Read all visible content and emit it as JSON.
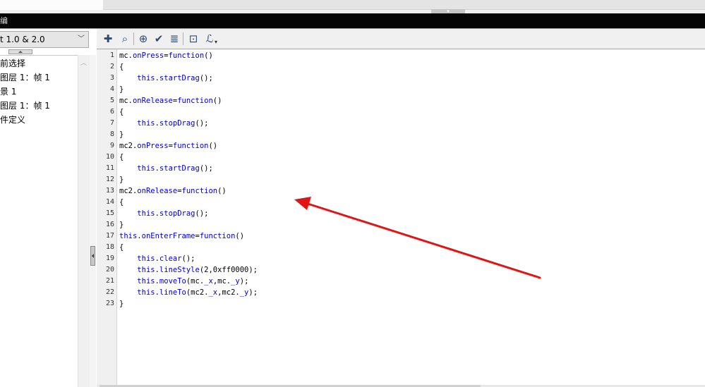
{
  "window": {
    "title_fragment": "编"
  },
  "left_panel": {
    "version_dropdown": {
      "selected": "t 1.0 & 2.0",
      "arrow": "chevron-down"
    },
    "tree_items": [
      {
        "label": "前选择"
      },
      {
        "label": " 图层 1：帧 1"
      },
      {
        "label": "景 1"
      },
      {
        "label": " 图层 1：帧 1"
      },
      {
        "label": "件定义"
      }
    ]
  },
  "toolbar": {
    "buttons": [
      {
        "name": "add-statement",
        "icon": "plus-icon",
        "glyph": "✚"
      },
      {
        "name": "find",
        "icon": "find-icon",
        "glyph": "⌕"
      },
      {
        "name": "insert-target-path",
        "icon": "crosshair-icon",
        "glyph": "⊕"
      },
      {
        "name": "check-syntax",
        "icon": "checkmark-icon",
        "glyph": "✔"
      },
      {
        "name": "auto-format",
        "icon": "format-icon",
        "glyph": "≣"
      },
      {
        "name": "show-code-hint",
        "icon": "code-hint-icon",
        "glyph": "⊡"
      },
      {
        "name": "debug-options",
        "icon": "debug-icon",
        "glyph": "ℒ"
      }
    ]
  },
  "editor": {
    "accent_keyword": "#0000c8",
    "lines": [
      {
        "n": "1",
        "parts": [
          [
            "mc.",
            ""
          ],
          [
            "onPress",
            "kw"
          ],
          [
            "=",
            ""
          ],
          [
            "function",
            "kw"
          ],
          [
            "()",
            ""
          ]
        ]
      },
      {
        "n": "2",
        "parts": [
          [
            "{",
            ""
          ]
        ]
      },
      {
        "n": "3",
        "parts": [
          [
            "    ",
            ""
          ],
          [
            "this",
            "kw"
          ],
          [
            ".",
            ""
          ],
          [
            "startDrag",
            "kw"
          ],
          [
            "();",
            ""
          ]
        ]
      },
      {
        "n": "4",
        "parts": [
          [
            "}",
            ""
          ]
        ]
      },
      {
        "n": "5",
        "parts": [
          [
            "mc.",
            ""
          ],
          [
            "onRelease",
            "kw"
          ],
          [
            "=",
            ""
          ],
          [
            "function",
            "kw"
          ],
          [
            "()",
            ""
          ]
        ]
      },
      {
        "n": "6",
        "parts": [
          [
            "{",
            ""
          ]
        ]
      },
      {
        "n": "7",
        "parts": [
          [
            "    ",
            ""
          ],
          [
            "this",
            "kw"
          ],
          [
            ".",
            ""
          ],
          [
            "stopDrag",
            "kw"
          ],
          [
            "();",
            ""
          ]
        ]
      },
      {
        "n": "8",
        "parts": [
          [
            "}",
            ""
          ]
        ]
      },
      {
        "n": "9",
        "parts": [
          [
            "mc2.",
            ""
          ],
          [
            "onPress",
            "kw"
          ],
          [
            "=",
            ""
          ],
          [
            "function",
            "kw"
          ],
          [
            "()",
            ""
          ]
        ]
      },
      {
        "n": "10",
        "parts": [
          [
            "{",
            ""
          ]
        ]
      },
      {
        "n": "11",
        "parts": [
          [
            "    ",
            ""
          ],
          [
            "this",
            "kw"
          ],
          [
            ".",
            ""
          ],
          [
            "startDrag",
            "kw"
          ],
          [
            "();",
            ""
          ]
        ]
      },
      {
        "n": "12",
        "parts": [
          [
            "}",
            ""
          ]
        ]
      },
      {
        "n": "13",
        "parts": [
          [
            "mc2.",
            ""
          ],
          [
            "onRelease",
            "kw"
          ],
          [
            "=",
            ""
          ],
          [
            "function",
            "kw"
          ],
          [
            "()",
            ""
          ]
        ]
      },
      {
        "n": "14",
        "parts": [
          [
            "{",
            ""
          ]
        ]
      },
      {
        "n": "15",
        "parts": [
          [
            "    ",
            ""
          ],
          [
            "this",
            "kw"
          ],
          [
            ".",
            ""
          ],
          [
            "stopDrag",
            "kw"
          ],
          [
            "();",
            ""
          ]
        ]
      },
      {
        "n": "16",
        "parts": [
          [
            "}",
            ""
          ]
        ]
      },
      {
        "n": "17",
        "parts": [
          [
            "this",
            "kw"
          ],
          [
            ".",
            ""
          ],
          [
            "onEnterFrame",
            "kw"
          ],
          [
            "=",
            ""
          ],
          [
            "function",
            "kw"
          ],
          [
            "()",
            ""
          ]
        ]
      },
      {
        "n": "18",
        "parts": [
          [
            "{",
            ""
          ]
        ]
      },
      {
        "n": "19",
        "parts": [
          [
            "    ",
            ""
          ],
          [
            "this",
            "kw"
          ],
          [
            ".",
            ""
          ],
          [
            "clear",
            "kw"
          ],
          [
            "();",
            ""
          ]
        ]
      },
      {
        "n": "20",
        "parts": [
          [
            "    ",
            ""
          ],
          [
            "this",
            "kw"
          ],
          [
            ".",
            ""
          ],
          [
            "lineStyle",
            "kw"
          ],
          [
            "(2,0xff0000);",
            ""
          ]
        ]
      },
      {
        "n": "21",
        "parts": [
          [
            "    ",
            ""
          ],
          [
            "this",
            "kw"
          ],
          [
            ".",
            ""
          ],
          [
            "moveTo",
            "kw"
          ],
          [
            "(mc.",
            ""
          ],
          [
            "_x",
            "kw"
          ],
          [
            ",mc.",
            ""
          ],
          [
            "_y",
            "kw"
          ],
          [
            ");",
            ""
          ]
        ]
      },
      {
        "n": "22",
        "parts": [
          [
            "    ",
            ""
          ],
          [
            "this",
            "kw"
          ],
          [
            ".",
            ""
          ],
          [
            "lineTo",
            "kw"
          ],
          [
            "(mc2.",
            ""
          ],
          [
            "_x",
            "kw"
          ],
          [
            ",mc2.",
            ""
          ],
          [
            "_y",
            "kw"
          ],
          [
            ");",
            ""
          ]
        ]
      },
      {
        "n": "23",
        "parts": [
          [
            "}",
            ""
          ]
        ]
      }
    ]
  },
  "annotation": {
    "icon": "red-arrow-icon",
    "color": "#e01515"
  }
}
